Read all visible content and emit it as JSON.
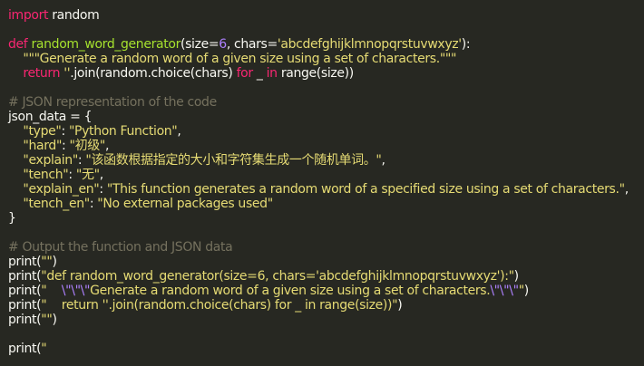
{
  "code": {
    "lines": [
      [
        {
          "t": "import",
          "c": "kw"
        },
        {
          "t": " random",
          "c": "pl"
        }
      ],
      [],
      [
        {
          "t": "def",
          "c": "kw"
        },
        {
          "t": " ",
          "c": "pl"
        },
        {
          "t": "random_word_generator",
          "c": "fn"
        },
        {
          "t": "(size=",
          "c": "pl"
        },
        {
          "t": "6",
          "c": "num"
        },
        {
          "t": ", chars=",
          "c": "pl"
        },
        {
          "t": "'abcdefghijklmnopqrstuvwxyz'",
          "c": "str"
        },
        {
          "t": "):",
          "c": "pl"
        }
      ],
      [
        {
          "t": "    ",
          "c": "pl"
        },
        {
          "t": "\"\"\"Generate a random word of a given size using a set of characters.\"\"\"",
          "c": "str"
        }
      ],
      [
        {
          "t": "    ",
          "c": "pl"
        },
        {
          "t": "return",
          "c": "kw"
        },
        {
          "t": " ",
          "c": "pl"
        },
        {
          "t": "''",
          "c": "str"
        },
        {
          "t": ".join(random.choice(chars) ",
          "c": "pl"
        },
        {
          "t": "for",
          "c": "kw"
        },
        {
          "t": " _ ",
          "c": "pl"
        },
        {
          "t": "in",
          "c": "kw"
        },
        {
          "t": " range(size))",
          "c": "pl"
        }
      ],
      [],
      [
        {
          "t": "# JSON representation of the code",
          "c": "cm"
        }
      ],
      [
        {
          "t": "json_data = {",
          "c": "pl"
        }
      ],
      [
        {
          "t": "    ",
          "c": "pl"
        },
        {
          "t": "\"type\"",
          "c": "str"
        },
        {
          "t": ": ",
          "c": "pl"
        },
        {
          "t": "\"Python Function\"",
          "c": "str"
        },
        {
          "t": ",",
          "c": "pl"
        }
      ],
      [
        {
          "t": "    ",
          "c": "pl"
        },
        {
          "t": "\"hard\"",
          "c": "str"
        },
        {
          "t": ": ",
          "c": "pl"
        },
        {
          "t": "\"初级\"",
          "c": "str"
        },
        {
          "t": ",",
          "c": "pl"
        }
      ],
      [
        {
          "t": "    ",
          "c": "pl"
        },
        {
          "t": "\"explain\"",
          "c": "str"
        },
        {
          "t": ": ",
          "c": "pl"
        },
        {
          "t": "\"该函数根据指定的大小和字符集生成一个随机单词。\"",
          "c": "str"
        },
        {
          "t": ",",
          "c": "pl"
        }
      ],
      [
        {
          "t": "    ",
          "c": "pl"
        },
        {
          "t": "\"tench\"",
          "c": "str"
        },
        {
          "t": ": ",
          "c": "pl"
        },
        {
          "t": "\"无\"",
          "c": "str"
        },
        {
          "t": ",",
          "c": "pl"
        }
      ],
      [
        {
          "t": "    ",
          "c": "pl"
        },
        {
          "t": "\"explain_en\"",
          "c": "str"
        },
        {
          "t": ": ",
          "c": "pl"
        },
        {
          "t": "\"This function generates a random word of a specified size using a set of characters.\"",
          "c": "str"
        },
        {
          "t": ",",
          "c": "pl"
        }
      ],
      [
        {
          "t": "    ",
          "c": "pl"
        },
        {
          "t": "\"tench_en\"",
          "c": "str"
        },
        {
          "t": ": ",
          "c": "pl"
        },
        {
          "t": "\"No external packages used\"",
          "c": "str"
        }
      ],
      [
        {
          "t": "}",
          "c": "pl"
        }
      ],
      [],
      [
        {
          "t": "# Output the function and JSON data",
          "c": "cm"
        }
      ],
      [
        {
          "t": "print(",
          "c": "pl"
        },
        {
          "t": "\"\"",
          "c": "str"
        },
        {
          "t": ")",
          "c": "pl"
        }
      ],
      [
        {
          "t": "print(",
          "c": "pl"
        },
        {
          "t": "\"def random_word_generator(size=6, chars='abcdefghijklmnopqrstuvwxyz'):\"",
          "c": "str"
        },
        {
          "t": ")",
          "c": "pl"
        }
      ],
      [
        {
          "t": "print(",
          "c": "pl"
        },
        {
          "t": "\"    ",
          "c": "str"
        },
        {
          "t": "\\\"\\\"\\\"",
          "c": "num"
        },
        {
          "t": "Generate a random word of a given size using a set of characters.",
          "c": "str"
        },
        {
          "t": "\\\"\\\"\\\"",
          "c": "num"
        },
        {
          "t": "\"",
          "c": "str"
        },
        {
          "t": ")",
          "c": "pl"
        }
      ],
      [
        {
          "t": "print(",
          "c": "pl"
        },
        {
          "t": "\"    return ''.join(random.choice(chars) for _ in range(size))\"",
          "c": "str"
        },
        {
          "t": ")",
          "c": "pl"
        }
      ],
      [
        {
          "t": "print(",
          "c": "pl"
        },
        {
          "t": "\"\"",
          "c": "str"
        },
        {
          "t": ")",
          "c": "pl"
        }
      ],
      [],
      [
        {
          "t": "print(",
          "c": "pl"
        },
        {
          "t": "\"",
          "c": "str"
        }
      ]
    ]
  }
}
